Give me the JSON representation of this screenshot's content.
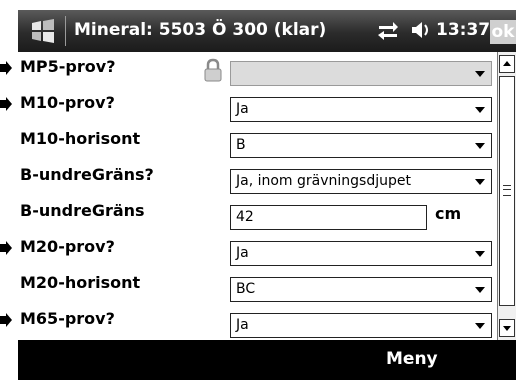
{
  "title": "Mineral: 5503 Ö 300 (klar)",
  "status": {
    "time": "13:37",
    "ok_label": "ok"
  },
  "form": {
    "rows": [
      {
        "label": "MP5-prov?",
        "value": "",
        "kind": "select-disabled",
        "marked": true
      },
      {
        "label": "M10-prov?",
        "value": "Ja",
        "kind": "select",
        "marked": true
      },
      {
        "label": "M10-horisont",
        "value": "B",
        "kind": "select",
        "marked": false
      },
      {
        "label": "B-undreGräns?",
        "value": "Ja, inom grävningsdjupet",
        "kind": "select",
        "marked": false
      },
      {
        "label": "B-undreGräns",
        "value": "42",
        "kind": "text",
        "unit": "cm",
        "marked": false
      },
      {
        "label": "M20-prov?",
        "value": "Ja",
        "kind": "select",
        "marked": true
      },
      {
        "label": "M20-horisont",
        "value": "BC",
        "kind": "select",
        "marked": false
      },
      {
        "label": "M65-prov?",
        "value": "Ja",
        "kind": "select",
        "marked": true
      }
    ]
  },
  "menubar": {
    "menu_label": "Meny"
  }
}
